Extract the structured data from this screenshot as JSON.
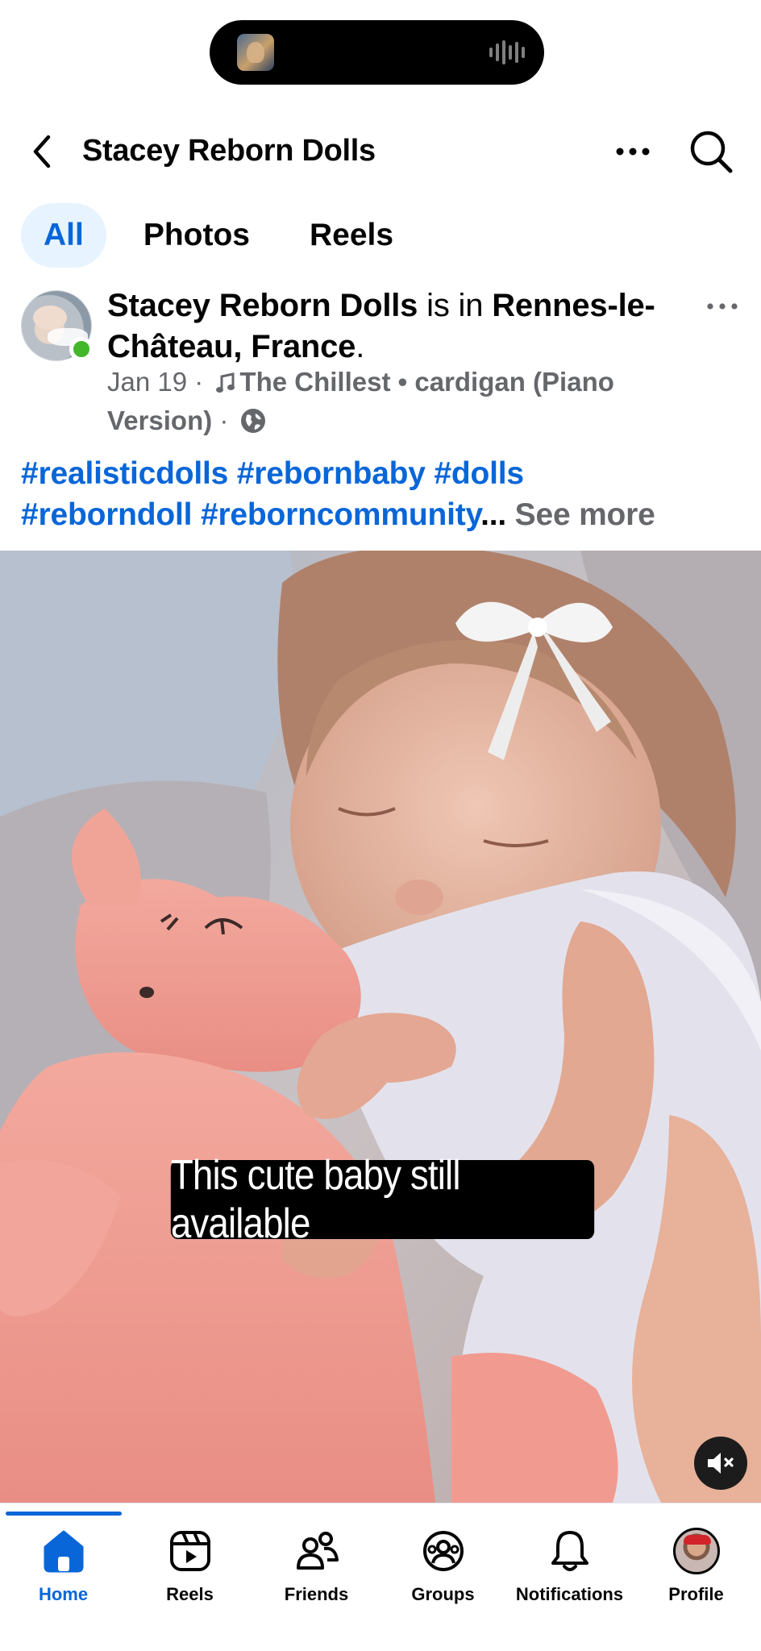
{
  "header": {
    "title": "Stacey Reborn Dolls",
    "back_icon": "chevron-left-icon",
    "more_icon": "more-horizontal-icon",
    "search_icon": "search-icon"
  },
  "tabs": [
    {
      "label": "All",
      "active": true
    },
    {
      "label": "Photos",
      "active": false
    },
    {
      "label": "Reels",
      "active": false
    }
  ],
  "post": {
    "author": "Stacey Reborn Dolls",
    "is_in": " is in ",
    "location": "Rennes-le-Château, France",
    "period": ".",
    "date": "Jan 19",
    "separator": " · ",
    "song": "The Chillest • cardigan (Piano Version)",
    "privacy_icon": "globe-icon",
    "hashtags_line1": "#realisticdolls #rebornbaby #dolls",
    "hashtags_line2": "#reborndoll #reborncommunity",
    "ellipsis": "...",
    "see_more": " See more"
  },
  "video": {
    "caption": "This cute baby still available",
    "mute_icon": "speaker-muted-icon"
  },
  "bottom_nav": [
    {
      "label": "Home",
      "icon": "home-icon",
      "active": true
    },
    {
      "label": "Reels",
      "icon": "reels-icon",
      "active": false
    },
    {
      "label": "Friends",
      "icon": "friends-icon",
      "active": false
    },
    {
      "label": "Groups",
      "icon": "groups-icon",
      "active": false
    },
    {
      "label": "Notifications",
      "icon": "bell-icon",
      "active": false
    },
    {
      "label": "Profile",
      "icon": "profile-avatar",
      "active": false
    }
  ],
  "colors": {
    "accent": "#0866d8",
    "accent_bg": "#e7f3ff",
    "secondary_text": "#65676b",
    "online": "#42b72a"
  }
}
